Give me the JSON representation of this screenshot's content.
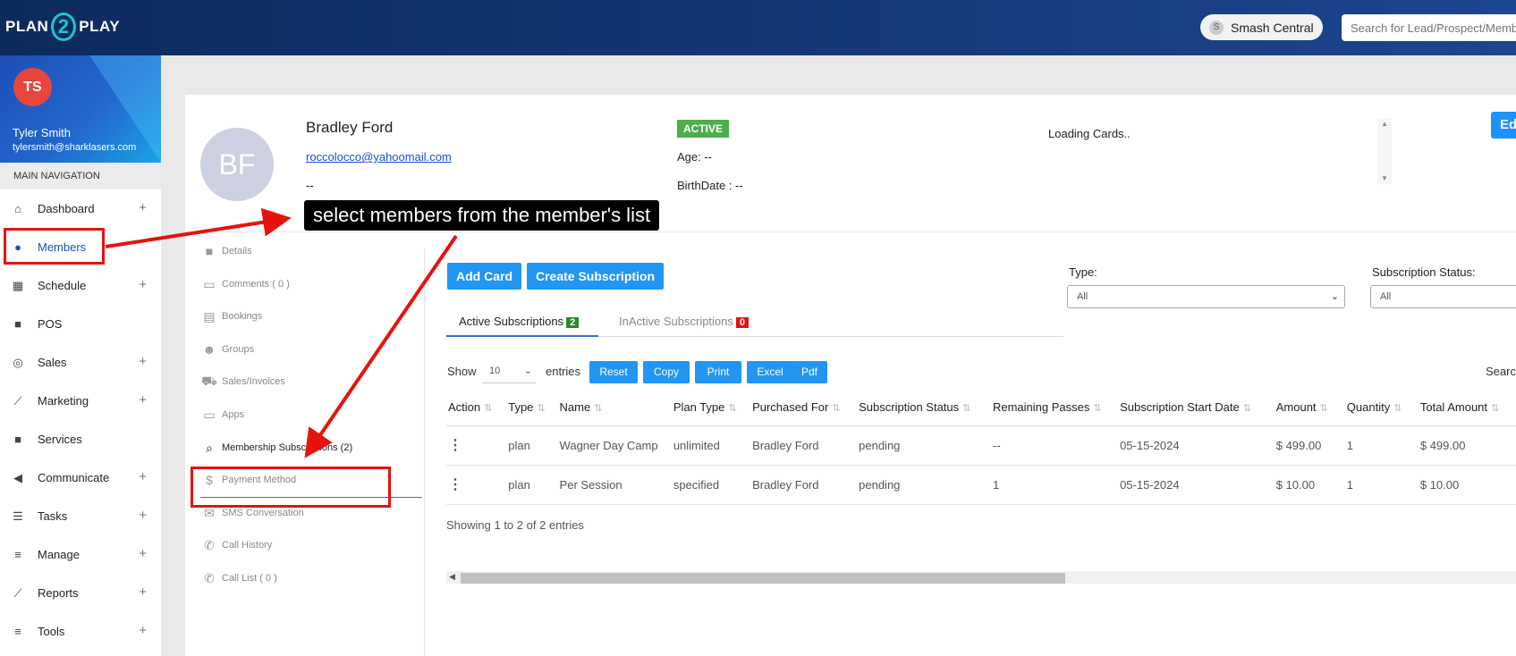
{
  "app": {
    "logo_left": "PLAN",
    "logo_mid": "2",
    "logo_right": "PLAY",
    "location": "Smash Central",
    "location_initial": "S",
    "search_placeholder": "Search for Lead/Prospect/Member"
  },
  "user": {
    "initials": "TS",
    "name": "Tyler Smith",
    "email": "tylersmith@sharklasers.com"
  },
  "sidebar": {
    "section_label": "MAIN NAVIGATION",
    "items": [
      {
        "label": "Dashboard",
        "icon": "home-icon",
        "has_plus": true
      },
      {
        "label": "Members",
        "icon": "user-circle-icon",
        "has_plus": false
      },
      {
        "label": "Schedule",
        "icon": "calendar-icon",
        "has_plus": true
      },
      {
        "label": "POS",
        "icon": "briefcase-icon",
        "has_plus": false
      },
      {
        "label": "Sales",
        "icon": "target-icon",
        "has_plus": true
      },
      {
        "label": "Marketing",
        "icon": "trend-icon",
        "has_plus": true
      },
      {
        "label": "Services",
        "icon": "briefcase-icon",
        "has_plus": false
      },
      {
        "label": "Communicate",
        "icon": "megaphone-icon",
        "has_plus": true
      },
      {
        "label": "Tasks",
        "icon": "list-icon",
        "has_plus": true
      },
      {
        "label": "Manage",
        "icon": "menu-icon",
        "has_plus": true
      },
      {
        "label": "Reports",
        "icon": "trend-icon",
        "has_plus": true
      },
      {
        "label": "Tools",
        "icon": "menu-icon",
        "has_plus": true
      }
    ],
    "plus": "+"
  },
  "profile": {
    "initials": "BF",
    "name": "Bradley Ford",
    "email": "roccolocco@yahoomail.com",
    "phone": "--",
    "status": "ACTIVE",
    "age": "Age: --",
    "birthdate": "BirthDate : --",
    "cards_status": "Loading Cards..",
    "edit_label": "Ed"
  },
  "subnav": [
    {
      "label": "Details",
      "icon": "folder-icon"
    },
    {
      "label": "Comments ( 0 )",
      "icon": "comment-icon"
    },
    {
      "label": "Bookings",
      "icon": "id-card-icon"
    },
    {
      "label": "Groups",
      "icon": "users-icon"
    },
    {
      "label": "Sales/Invoices",
      "icon": "cart-icon"
    },
    {
      "label": "Apps",
      "icon": "laptop-icon"
    },
    {
      "label": "Membership Subscriptions (2)",
      "icon": "search-box-icon"
    },
    {
      "label": "Payment Method",
      "icon": "dollar-icon"
    },
    {
      "label": "SMS Conversation",
      "icon": "envelope-icon"
    },
    {
      "label": "Call History",
      "icon": "phone-icon"
    },
    {
      "label": "Call List ( 0 )",
      "icon": "phone-icon"
    }
  ],
  "actions": {
    "add_card": "Add Card",
    "create_subscription": "Create Subscription"
  },
  "filters": {
    "type_label": "Type:",
    "type_value": "All",
    "status_label": "Subscription Status:",
    "status_value": "All"
  },
  "tabs": {
    "active_label": "Active Subscriptions",
    "active_count": "2",
    "inactive_label": "InActive Subscriptions",
    "inactive_count": "0"
  },
  "table_controls": {
    "show": "Show",
    "length": "10",
    "entries": "entries",
    "buttons": [
      "Reset",
      "Copy",
      "Print",
      "Excel",
      "Pdf"
    ],
    "search": "Search:"
  },
  "table": {
    "headers": [
      "Action",
      "Type",
      "Name",
      "Plan Type",
      "Purchased For",
      "Subscription Status",
      "Remaining Passes",
      "Subscription Start Date",
      "Amount",
      "Quantity",
      "Total Amount"
    ],
    "rows": [
      [
        "⋮",
        "plan",
        "Wagner Day Camp",
        "unlimited",
        "Bradley Ford",
        "pending",
        "--",
        "05-15-2024",
        "$ 499.00",
        "1",
        "$ 499.00"
      ],
      [
        "⋮",
        "plan",
        "Per Session",
        "specified",
        "Bradley Ford",
        "pending",
        "1",
        "05-15-2024",
        "$ 10.00",
        "1",
        "$ 10.00"
      ]
    ],
    "footer": "Showing 1 to 2 of 2 entries"
  },
  "annotation": {
    "tooltip": "select members from the member's list",
    "color": "#e8120c"
  }
}
